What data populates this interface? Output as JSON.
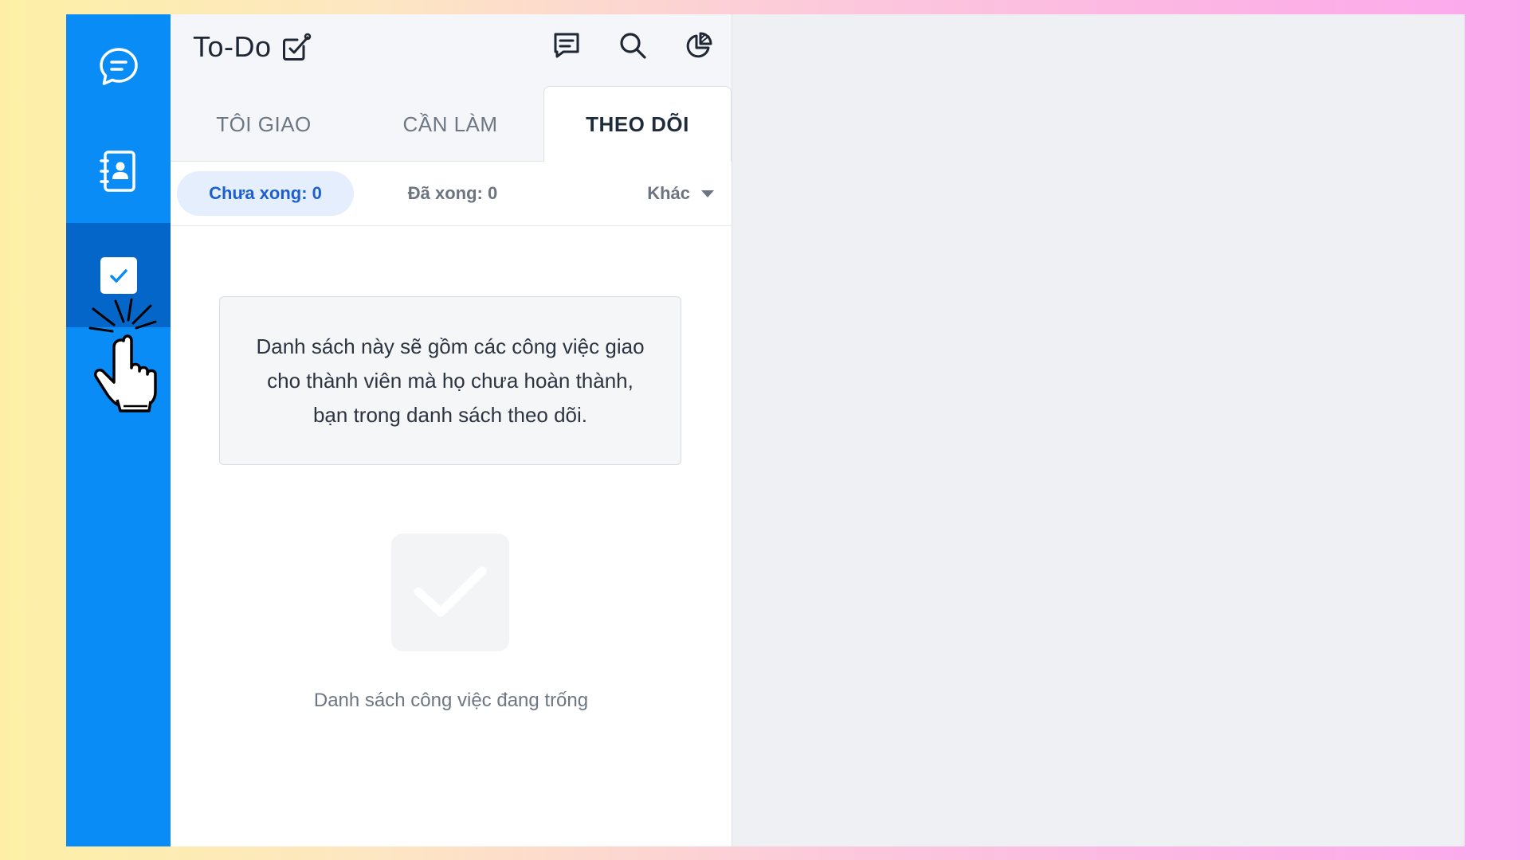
{
  "app": {
    "title": "To-Do",
    "icons": [
      "chat-icon",
      "contacts-icon",
      "todo-icon",
      "comment-icon",
      "search-icon",
      "chart-icon",
      "edit-square-icon"
    ],
    "accent_color": "#0a8cf7",
    "rail_active_color": "#0566c9"
  },
  "tabs": [
    {
      "label": "TÔI GIAO",
      "active": false
    },
    {
      "label": "CẦN LÀM",
      "active": false
    },
    {
      "label": "THEO DÕI",
      "active": true
    }
  ],
  "filters": {
    "pending": "Chưa xong: 0",
    "done": "Đã xong: 0",
    "other": "Khác"
  },
  "info_text": "Danh sách này sẽ gồm các công việc giao cho thành viên mà họ chưa hoàn thành, bạn trong danh sách theo dõi.",
  "empty_text": "Danh sách công việc đang trống"
}
